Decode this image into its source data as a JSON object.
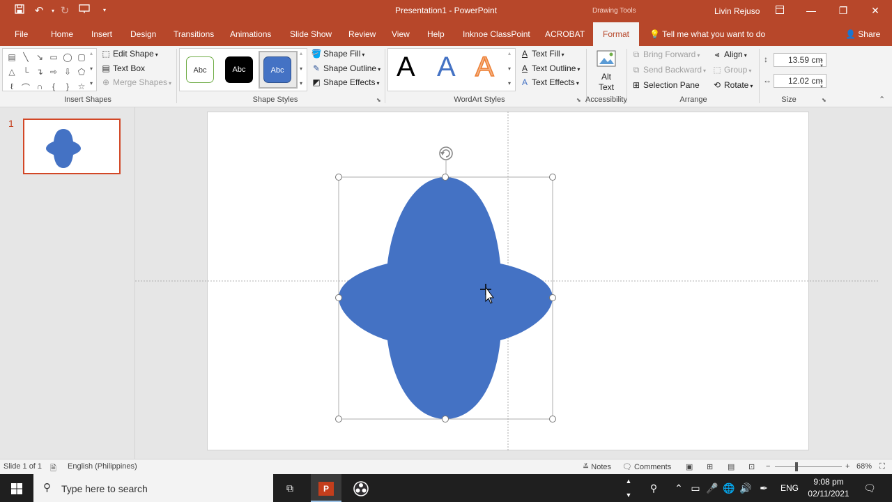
{
  "window": {
    "doc_title": "Presentation1  -  PowerPoint",
    "context_label": "Drawing Tools",
    "user": "Livin Rejuso"
  },
  "tabs": [
    {
      "label": "File"
    },
    {
      "label": "Home"
    },
    {
      "label": "Insert"
    },
    {
      "label": "Design"
    },
    {
      "label": "Transitions"
    },
    {
      "label": "Animations"
    },
    {
      "label": "Slide Show"
    },
    {
      "label": "Review"
    },
    {
      "label": "View"
    },
    {
      "label": "Help"
    },
    {
      "label": "Inknoe ClassPoint"
    },
    {
      "label": "ACROBAT"
    },
    {
      "label": "Format"
    }
  ],
  "tell_me": "Tell me what you want to do",
  "share": "Share",
  "ribbon": {
    "insert_shapes": {
      "edit_shape": "Edit Shape",
      "text_box": "Text Box",
      "merge_shapes": "Merge Shapes",
      "label": "Insert Shapes"
    },
    "shape_styles": {
      "swatch_text": "Abc",
      "shape_fill": "Shape Fill",
      "shape_outline": "Shape Outline",
      "shape_effects": "Shape Effects",
      "label": "Shape Styles"
    },
    "wordart": {
      "letter": "A",
      "text_fill": "Text Fill",
      "text_outline": "Text Outline",
      "text_effects": "Text Effects",
      "label": "WordArt Styles"
    },
    "accessibility": {
      "alt_text_1": "Alt",
      "alt_text_2": "Text",
      "label": "Accessibility"
    },
    "arrange": {
      "bring_forward": "Bring Forward",
      "send_backward": "Send Backward",
      "selection_pane": "Selection Pane",
      "align": "Align",
      "group": "Group",
      "rotate": "Rotate",
      "label": "Arrange"
    },
    "size": {
      "height": "13.59 cm",
      "width": "12.02 cm",
      "label": "Size"
    }
  },
  "thumbnails": {
    "slide_number": "1"
  },
  "colors": {
    "accent": "#b7472a",
    "shape_fill": "#4472c4"
  },
  "status": {
    "slide": "Slide 1 of 1",
    "language": "English (Philippines)",
    "notes": "Notes",
    "comments": "Comments",
    "zoom": "68%"
  },
  "taskbar": {
    "search_placeholder": "Type here to search",
    "lang": "ENG",
    "time": "9:08 pm",
    "date": "02/11/2021"
  }
}
